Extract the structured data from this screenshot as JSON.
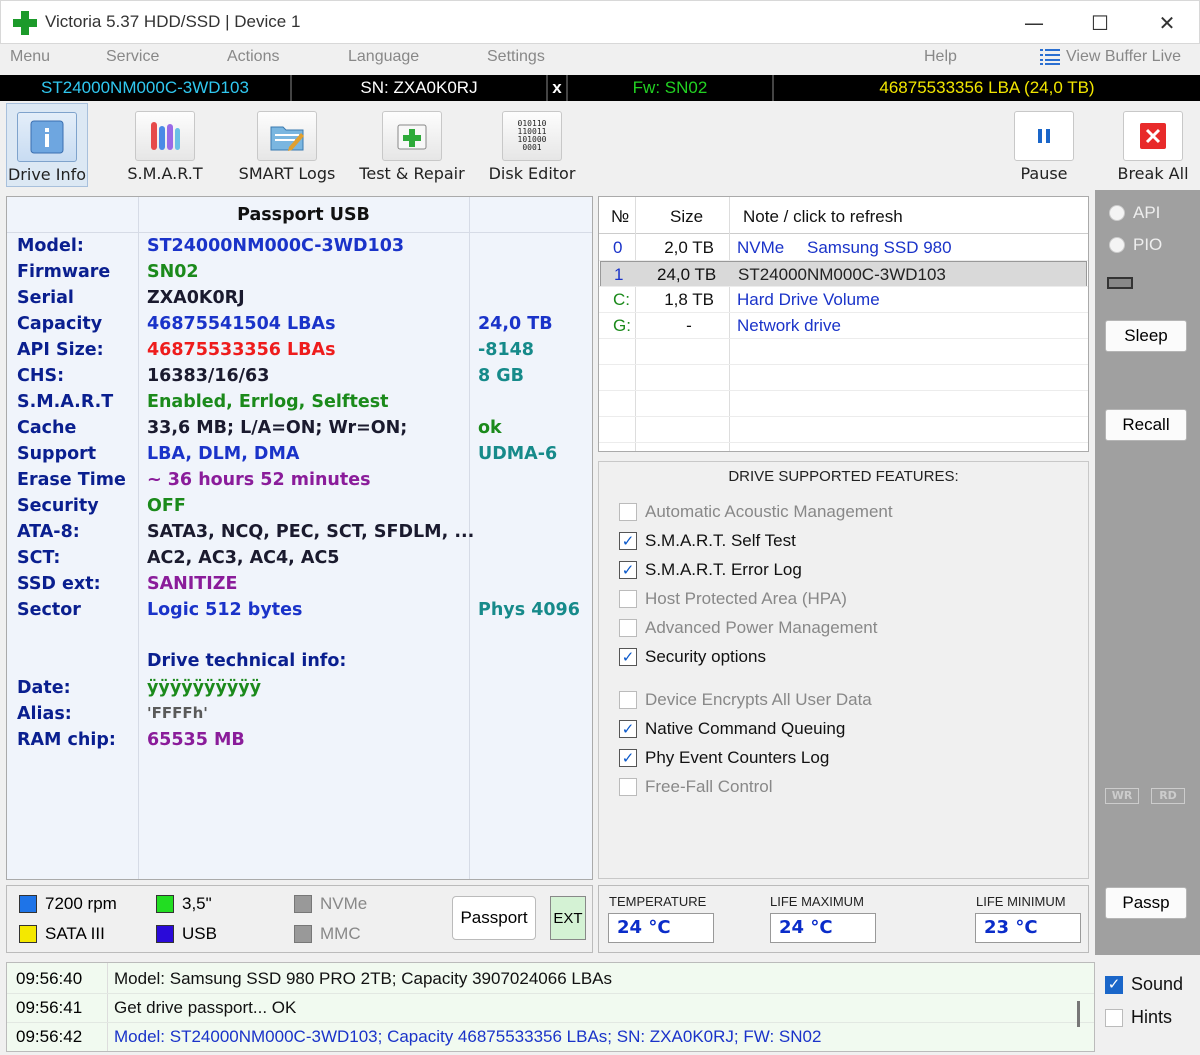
{
  "window": {
    "title": "Victoria 5.37 HDD/SSD | Device 1"
  },
  "menu": {
    "items": [
      "Menu",
      "Service",
      "Actions",
      "Language",
      "Settings",
      "Help"
    ],
    "view_buffer": "View Buffer Live"
  },
  "devicebar": {
    "model": "ST24000NM000C-3WD103",
    "serial": "SN: ZXA0K0RJ",
    "close": "x",
    "firmware": "Fw: SN02",
    "lba": "46875533356 LBA (24,0 TB)"
  },
  "toolbar": {
    "drive_info": "Drive Info",
    "smart": "S.M.A.R.T",
    "smart_logs": "SMART Logs",
    "test_repair": "Test & Repair",
    "disk_editor": "Disk Editor",
    "disk_editor_glyph": [
      "010110",
      "110011",
      "101000",
      "0001"
    ],
    "pause": "Pause",
    "break_all": "Break All"
  },
  "passport": {
    "header": "Passport USB",
    "rows": [
      {
        "key": "Model:",
        "value": "ST24000NM000C-3WD103",
        "extra": ""
      },
      {
        "key": "Firmware",
        "value": "SN02",
        "extra": ""
      },
      {
        "key": "Serial",
        "value": "ZXA0K0RJ",
        "extra": ""
      },
      {
        "key": "Capacity",
        "value": "46875541504 LBAs",
        "extra": "24,0 TB"
      },
      {
        "key": "API Size:",
        "value": "46875533356 LBAs",
        "extra": "-8148"
      },
      {
        "key": "CHS:",
        "value": "16383/16/63",
        "extra": "8 GB"
      },
      {
        "key": "S.M.A.R.T",
        "value": "Enabled, Errlog, Selftest",
        "extra": ""
      },
      {
        "key": "Cache",
        "value": "33,6 MB; L/A=ON; Wr=ON;",
        "extra": "ok"
      },
      {
        "key": "Support",
        "value": "LBA, DLM, DMA",
        "extra": "UDMA-6"
      },
      {
        "key": "Erase Time",
        "value": "~ 36 hours 52 minutes",
        "extra": ""
      },
      {
        "key": "Security",
        "value": "OFF",
        "extra": ""
      },
      {
        "key": "ATA-8:",
        "value": "SATA3, NCQ, PEC, SCT, SFDLM, ...",
        "extra": ""
      },
      {
        "key": "SCT:",
        "value": "AC2, AC3, AC4, AC5",
        "extra": ""
      },
      {
        "key": "SSD ext:",
        "value": "SANITIZE",
        "extra": ""
      },
      {
        "key": "Sector",
        "value": "Logic 512 bytes",
        "extra": "Phys 4096"
      }
    ],
    "tech_header": "Drive technical info:",
    "tech_rows": [
      {
        "key": "Date:",
        "value": "ÿÿÿÿÿÿÿÿÿÿ"
      },
      {
        "key": "Alias:",
        "value": "'FFFFh'"
      },
      {
        "key": "RAM chip:",
        "value": "65535 MB"
      }
    ],
    "colors": {
      "key": "#0a1f8f",
      "blue": "#1a33c9",
      "green": "#1b8a1b",
      "red": "#ee1c1c",
      "teal": "#168a8a",
      "purple": "#8a1c9a",
      "darkgray": "#5a5a5a",
      "dark": "#1a1a2e"
    }
  },
  "drivelist": {
    "headers": {
      "num": "№",
      "size": "Size",
      "note": "Note / click to refresh"
    },
    "rows": [
      {
        "num": "0",
        "size": "2,0 TB",
        "note": "NVMe",
        "note2": "Samsung SSD 980"
      },
      {
        "num": "1",
        "size": "24,0 TB",
        "note": "ST24000NM000C-3WD103",
        "note2": ""
      },
      {
        "num": "C:",
        "size": "1,8 TB",
        "note": "Hard Drive Volume",
        "note2": ""
      },
      {
        "num": "G:",
        "size": "-",
        "note": "Network drive",
        "note2": ""
      }
    ]
  },
  "features": {
    "title": "DRIVE SUPPORTED FEATURES:",
    "items": [
      {
        "label": "Automatic Acoustic Management",
        "checked": false
      },
      {
        "label": "S.M.A.R.T. Self Test",
        "checked": true
      },
      {
        "label": "S.M.A.R.T. Error Log",
        "checked": true
      },
      {
        "label": "Host Protected Area (HPA)",
        "checked": false
      },
      {
        "label": "Advanced Power Management",
        "checked": false
      },
      {
        "label": "Security options",
        "checked": true
      },
      {
        "label": "Device Encrypts All User Data",
        "checked": false
      },
      {
        "label": "Native Command Queuing",
        "checked": true
      },
      {
        "label": "Phy Event Counters Log",
        "checked": true
      },
      {
        "label": "Free-Fall Control",
        "checked": false
      }
    ],
    "checkmark": "✓"
  },
  "rightpanel": {
    "api": "API",
    "pio": "PIO",
    "sleep": "Sleep",
    "recall": "Recall",
    "wr": "WR",
    "rd": "RD",
    "passp": "Passp"
  },
  "legend": {
    "rpm": "7200 rpm",
    "form": "3,5\"",
    "nvme": "NVMe",
    "sata": "SATA III",
    "usb": "USB",
    "mmc": "MMC",
    "passport_btn": "Passport",
    "ext_btn": "EXT"
  },
  "temps": {
    "temperature_label": "TEMPERATURE",
    "temperature": "24 °C",
    "life_max_label": "LIFE MAXIMUM",
    "life_max": "24 °C",
    "life_min_label": "LIFE MINIMUM",
    "life_min": "23 °C"
  },
  "log": [
    {
      "time": "09:56:40",
      "msg": "Model: Samsung SSD 980 PRO 2TB; Capacity 3907024066 LBAs",
      "color": "#111"
    },
    {
      "time": "09:56:41",
      "msg": "Get drive passport... OK",
      "color": "#111"
    },
    {
      "time": "09:56:42",
      "msg": "Model: ST24000NM000C-3WD103; Capacity 46875533356 LBAs; SN: ZXA0K0RJ; FW: SN02",
      "color": "#1a33c9"
    }
  ],
  "options": {
    "sound": "Sound",
    "sound_checked": true,
    "hints": "Hints",
    "hints_checked": false
  }
}
